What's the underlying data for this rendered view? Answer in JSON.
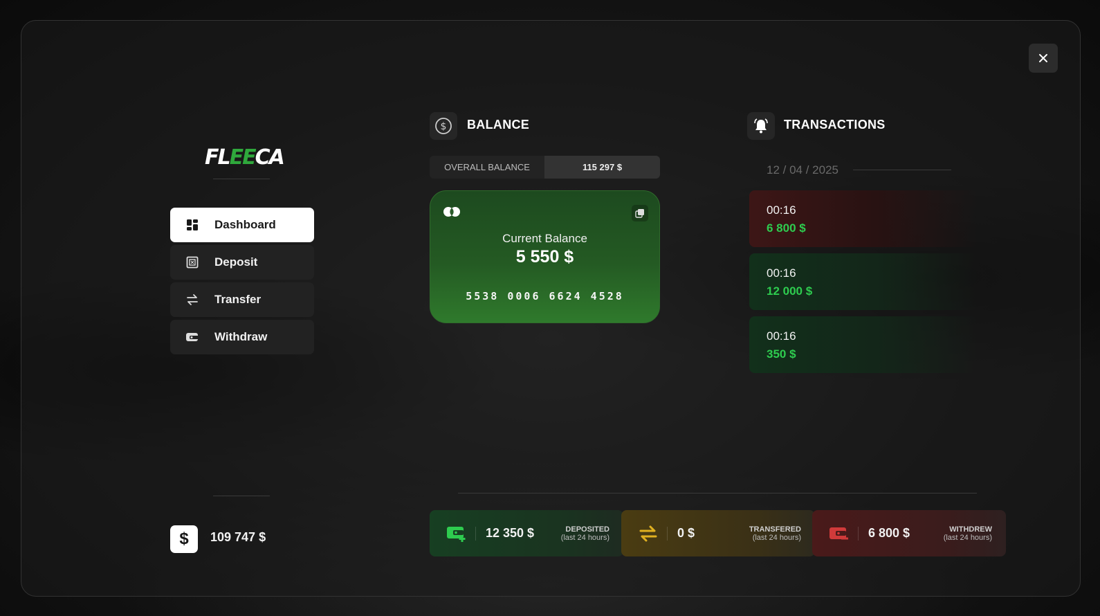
{
  "app": {
    "logo_text_pre": "FL",
    "logo_text_mid": "EE",
    "logo_text_post": "CA"
  },
  "sidebar": {
    "items": [
      {
        "label": "Dashboard",
        "icon": "dashboard-icon",
        "active": true
      },
      {
        "label": "Deposit",
        "icon": "deposit-icon",
        "active": false
      },
      {
        "label": "Transfer",
        "icon": "transfer-icon",
        "active": false
      },
      {
        "label": "Withdraw",
        "icon": "withdraw-icon",
        "active": false
      }
    ],
    "cash_symbol": "$",
    "cash_value": "109 747 $"
  },
  "balance": {
    "title": "BALANCE",
    "overall_label": "OVERALL BALANCE",
    "overall_value": "115 297 $",
    "card": {
      "label": "Current Balance",
      "value": "5 550 $",
      "number": "5538 0006 6624 4528"
    }
  },
  "transactions": {
    "title": "TRANSACTIONS",
    "date": "12 / 04 / 2025",
    "items": [
      {
        "time": "00:16",
        "amount": "6 800 $",
        "type": "red"
      },
      {
        "time": "00:16",
        "amount": "12 000 $",
        "type": "green"
      },
      {
        "time": "00:16",
        "amount": "350 $",
        "type": "green"
      }
    ]
  },
  "stats": {
    "deposited": {
      "value": "12 350 $",
      "label": "DEPOSITED",
      "sub": "(last 24 hours)"
    },
    "transfered": {
      "value": "0 $",
      "label": "TRANSFERED",
      "sub": "(last 24 hours)"
    },
    "withdrew": {
      "value": "6 800 $",
      "label": "WITHDREW",
      "sub": "(last 24 hours)"
    }
  },
  "colors": {
    "accent_green": "#2ecc4f",
    "card_green": "#245a23",
    "transfer_yellow": "#e0b020",
    "withdraw_red": "#d03a3a"
  }
}
